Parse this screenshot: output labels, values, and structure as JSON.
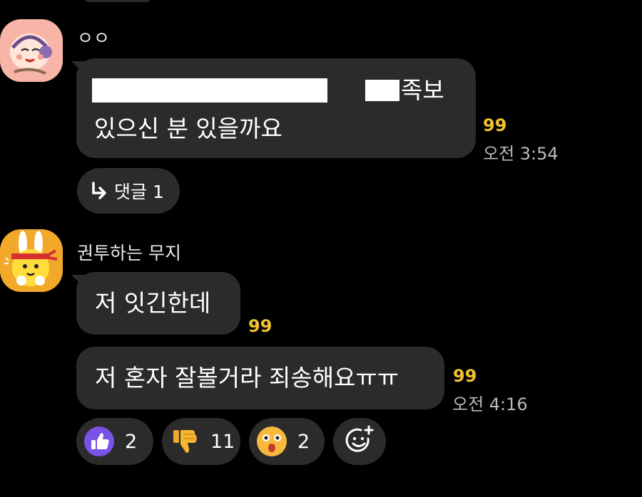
{
  "messages": [
    {
      "sender": "ㅇㅇ",
      "lines": [
        "족보",
        "있으신 분 있을까요"
      ],
      "read_count": "99",
      "time": "오전 3:54",
      "reply_label": "댓글 1"
    },
    {
      "sender": "권투하는 무지",
      "bubbles": [
        "저 잇긴한데",
        "저 혼자 잘볼거라 죄송해요ㅠㅠ"
      ],
      "read_counts": [
        "99",
        "99"
      ],
      "time": "오전 4:16"
    }
  ],
  "reactions": [
    {
      "icon": "thumbs-up-icon",
      "count": "2"
    },
    {
      "icon": "thumbs-down-icon",
      "count": "11"
    },
    {
      "icon": "surprised-face-icon",
      "count": "2"
    }
  ],
  "add_reaction_icon": "add-emoji-icon",
  "colors": {
    "background": "#000000",
    "bubble": "#2b2b2b",
    "read_count": "#f1c232",
    "timestamp": "#b9b9b9"
  }
}
